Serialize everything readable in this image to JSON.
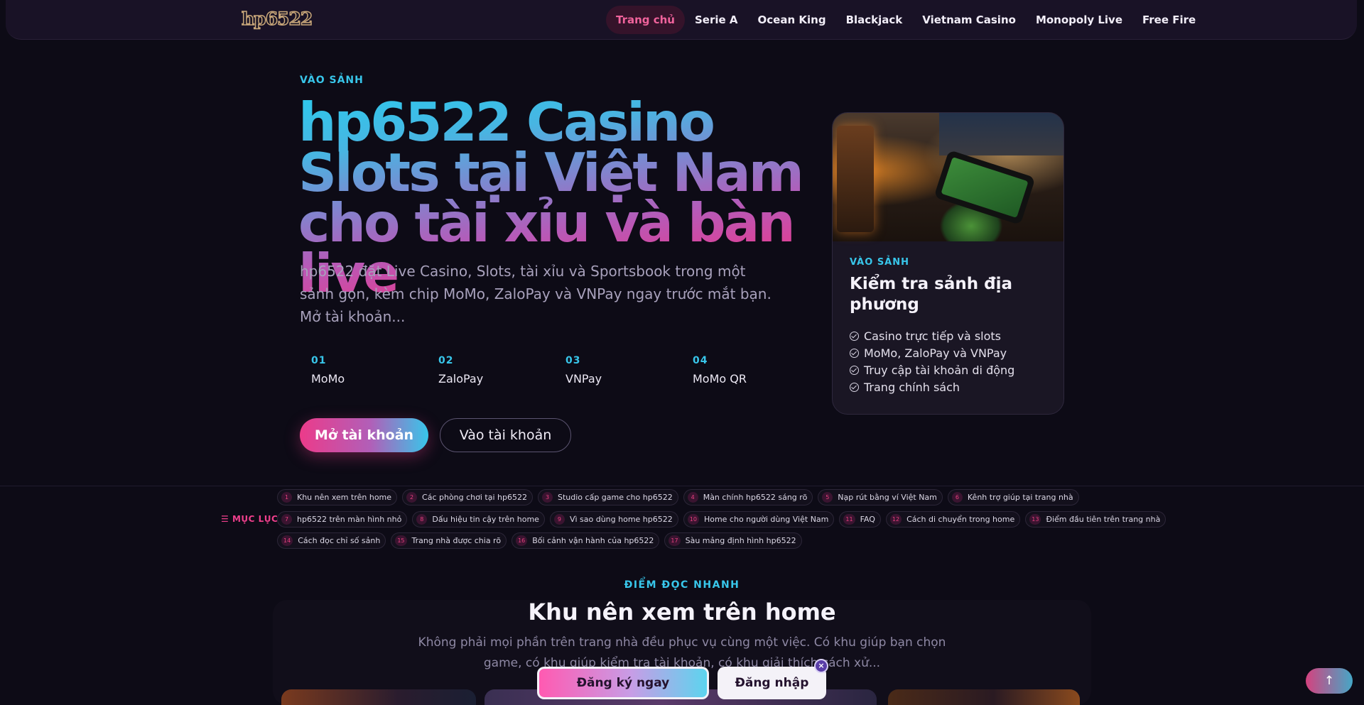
{
  "header": {
    "logo": "hp6522",
    "nav": [
      "Trang chủ",
      "Serie A",
      "Ocean King",
      "Blackjack",
      "Vietnam Casino",
      "Monopoly Live",
      "Free Fire"
    ]
  },
  "hero": {
    "kicker": "VÀO SẢNH",
    "title": "hp6522 Casino Slots tại Việt Nam cho tài xỉu và bàn live",
    "description": "hp6522 đặt Live Casino, Slots, tài xỉu và Sportsbook trong một sảnh gọn, kèm chip MoMo, ZaloPay và VNPay ngay trước mắt bạn. Mở tài khoản...",
    "payments": [
      {
        "num": "01",
        "name": "MoMo"
      },
      {
        "num": "02",
        "name": "ZaloPay"
      },
      {
        "num": "03",
        "name": "VNPay"
      },
      {
        "num": "04",
        "name": "MoMo QR"
      }
    ],
    "primary_button": "Mở tài khoản",
    "secondary_button": "Vào tài khoản"
  },
  "card": {
    "kicker": "VÀO SẢNH",
    "title": "Kiểm tra sảnh địa phương",
    "items": [
      "Casino trực tiếp và slots",
      "MoMo, ZaloPay và VNPay",
      "Truy cập tài khoản di động",
      "Trang chính sách"
    ]
  },
  "toc": {
    "label": "MỤC LỤC",
    "rows": [
      [
        {
          "num": "1",
          "text": "Khu nên xem trên home"
        },
        {
          "num": "2",
          "text": "Các phòng chơi tại hp6522"
        },
        {
          "num": "3",
          "text": "Studio cấp game cho hp6522"
        },
        {
          "num": "4",
          "text": "Màn chính hp6522 sáng rõ"
        },
        {
          "num": "5",
          "text": "Nạp rút bằng ví Việt Nam"
        },
        {
          "num": "6",
          "text": "Kênh trợ giúp tại trang nhà"
        }
      ],
      [
        {
          "num": "7",
          "text": "hp6522 trên màn hình nhỏ"
        },
        {
          "num": "8",
          "text": "Dấu hiệu tin cậy trên home"
        },
        {
          "num": "9",
          "text": "Vì sao dùng home hp6522"
        },
        {
          "num": "10",
          "text": "Home cho người dùng Việt Nam"
        },
        {
          "num": "11",
          "text": "FAQ"
        },
        {
          "num": "12",
          "text": "Cách di chuyển trong home"
        },
        {
          "num": "13",
          "text": "Điểm đầu tiên trên trang nhà"
        }
      ],
      [
        {
          "num": "14",
          "text": "Cách đọc chỉ số sảnh"
        },
        {
          "num": "15",
          "text": "Trang nhà được chia rõ"
        },
        {
          "num": "16",
          "text": "Bối cảnh vận hành của hp6522"
        },
        {
          "num": "17",
          "text": "Sàu mảng định hình hp6522"
        }
      ]
    ]
  },
  "section": {
    "kicker": "ĐIỂM ĐỌC NHANH",
    "title": "Khu nên xem trên home",
    "description": "Không phải mọi phần trên trang nhà đều phục vụ cùng một việc. Có khu giúp bạn chọn game, có khu giúp kiểm tra tài khoản, có khu giải thích cách xử..."
  },
  "sticky": {
    "signup": "Đăng ký ngay",
    "login": "Đăng nhập",
    "close": "×"
  },
  "back_to_top": "↑"
}
